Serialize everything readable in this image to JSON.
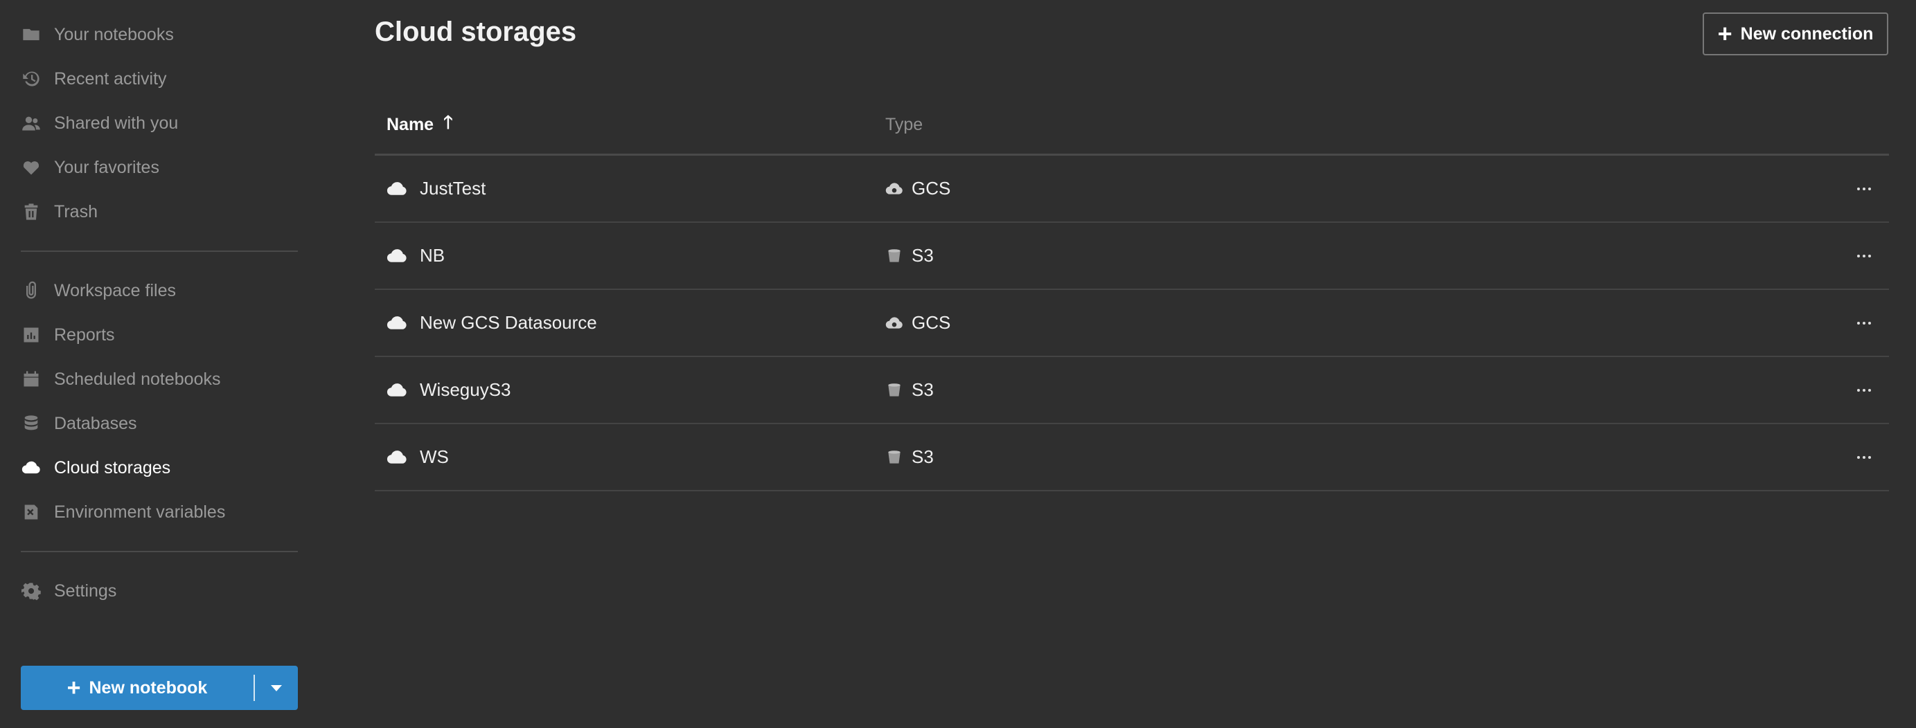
{
  "sidebar": {
    "items": [
      {
        "label": "Your notebooks",
        "icon": "folder-icon"
      },
      {
        "label": "Recent activity",
        "icon": "history-icon"
      },
      {
        "label": "Shared with you",
        "icon": "users-icon"
      },
      {
        "label": "Your favorites",
        "icon": "heart-icon"
      },
      {
        "label": "Trash",
        "icon": "trash-icon"
      },
      {
        "label": "Workspace files",
        "icon": "paperclip-icon"
      },
      {
        "label": "Reports",
        "icon": "report-icon"
      },
      {
        "label": "Scheduled notebooks",
        "icon": "calendar-icon"
      },
      {
        "label": "Databases",
        "icon": "database-icon"
      },
      {
        "label": "Cloud storages",
        "icon": "cloud-icon",
        "active": true
      },
      {
        "label": "Environment variables",
        "icon": "variable-icon"
      },
      {
        "label": "Settings",
        "icon": "gear-icon"
      }
    ],
    "new_notebook_label": "New notebook"
  },
  "header": {
    "title": "Cloud storages",
    "new_connection_label": "New connection"
  },
  "table": {
    "columns": [
      {
        "label": "Name",
        "sort": "ascending"
      },
      {
        "label": "Type"
      }
    ],
    "rows": [
      {
        "name": "JustTest",
        "type": "GCS"
      },
      {
        "name": "NB",
        "type": "S3"
      },
      {
        "name": "New GCS Datasource",
        "type": "GCS"
      },
      {
        "name": "WiseguyS3",
        "type": "S3"
      },
      {
        "name": "WS",
        "type": "S3"
      }
    ]
  },
  "colors": {
    "background": "#2f2f2f",
    "accent": "#2e86c8",
    "muted": "#9a9a9a"
  }
}
